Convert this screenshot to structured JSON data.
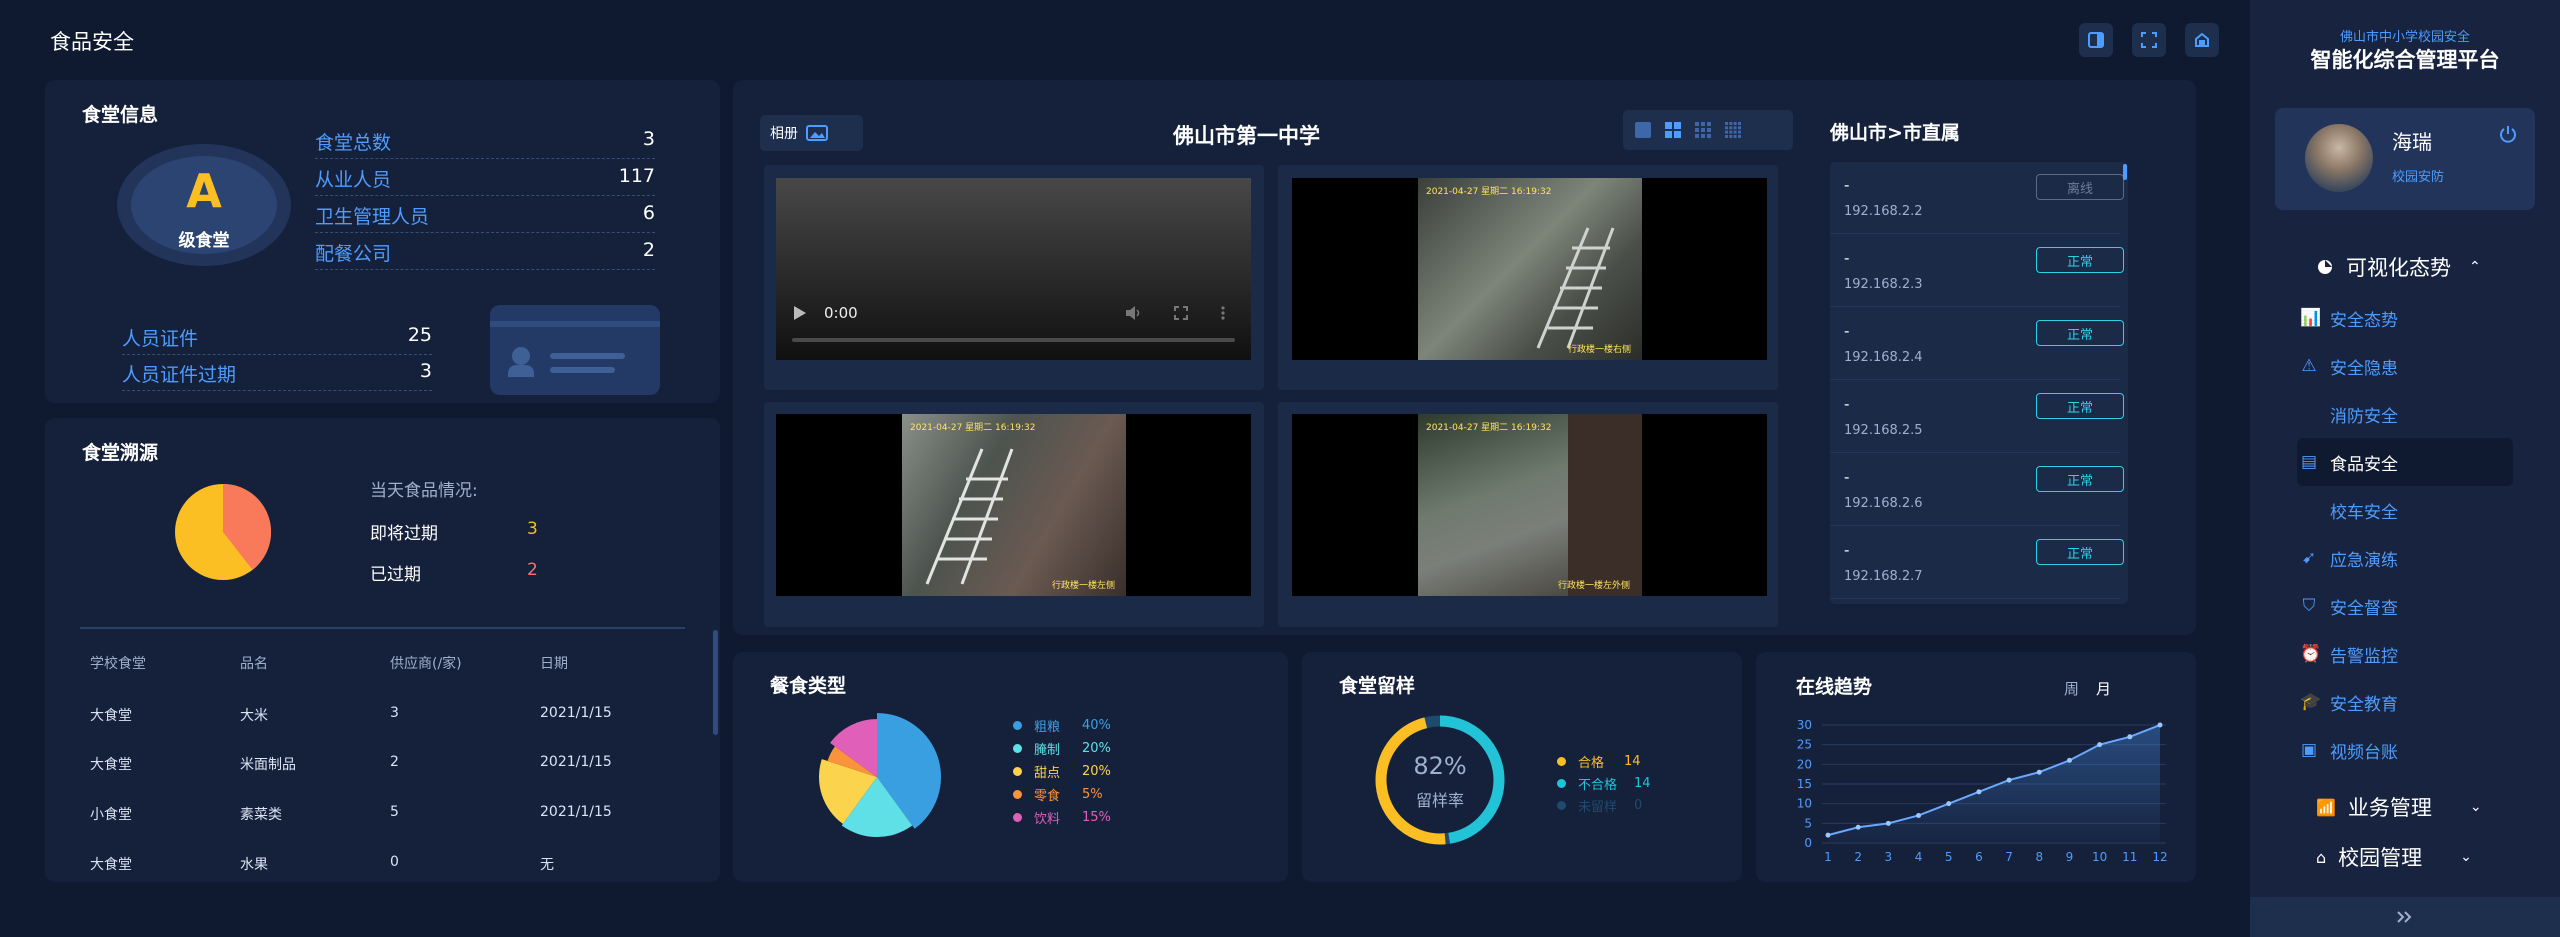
{
  "header": {
    "title": "食品安全"
  },
  "canteen_info": {
    "title": "食堂信息",
    "grade": "A",
    "grade_label": "级食堂",
    "stats": [
      {
        "label": "食堂总数",
        "value": "3"
      },
      {
        "label": "从业人员",
        "value": "117"
      },
      {
        "label": "卫生管理人员",
        "value": "6"
      },
      {
        "label": "配餐公司",
        "value": "2"
      }
    ],
    "certs": [
      {
        "label": "人员证件",
        "value": "25"
      },
      {
        "label": "人员证件过期",
        "value": "3"
      }
    ]
  },
  "traceability": {
    "title": "食堂溯源",
    "today_label": "当天食品情况:",
    "expiring_label": "即将过期",
    "expiring_value": "3",
    "expired_label": "已过期",
    "expired_value": "2",
    "columns": [
      "学校食堂",
      "品名",
      "供应商(/家)",
      "日期"
    ],
    "rows": [
      [
        "大食堂",
        "大米",
        "3",
        "2021/1/15"
      ],
      [
        "大食堂",
        "米面制品",
        "2",
        "2021/1/15"
      ],
      [
        "小食堂",
        "素菜类",
        "5",
        "2021/1/15"
      ],
      [
        "大食堂",
        "水果",
        "0",
        "无"
      ]
    ]
  },
  "video": {
    "album_label": "相册",
    "school_title": "佛山市第一中学",
    "player_time": "0:00",
    "cams": [
      {
        "stamp": "2021-04-27 星期二 16:19:32",
        "caption": "行政楼一楼右侧"
      },
      {
        "stamp": "2021-04-27 星期二 16:19:32",
        "caption": "行政楼一楼左侧"
      },
      {
        "stamp": "2021-04-27 星期二 16:19:32",
        "caption": "行政楼一楼左外侧"
      }
    ]
  },
  "devices": {
    "title": "佛山市>市直属",
    "items": [
      {
        "name": "-",
        "ip": "192.168.2.2",
        "status": "离线"
      },
      {
        "name": "-",
        "ip": "192.168.2.3",
        "status": "正常"
      },
      {
        "name": "-",
        "ip": "192.168.2.4",
        "status": "正常"
      },
      {
        "name": "-",
        "ip": "192.168.2.5",
        "status": "正常"
      },
      {
        "name": "-",
        "ip": "192.168.2.6",
        "status": "正常"
      },
      {
        "name": "-",
        "ip": "192.168.2.7",
        "status": "正常"
      }
    ]
  },
  "meal_types": {
    "title": "餐食类型",
    "items": [
      {
        "name": "粗粮",
        "pct": "40%",
        "value": 40,
        "color": "#3a9fe0"
      },
      {
        "name": "腌制",
        "pct": "20%",
        "value": 20,
        "color": "#5fe0e6"
      },
      {
        "name": "甜点",
        "pct": "20%",
        "value": 20,
        "color": "#fcd34d"
      },
      {
        "name": "零食",
        "pct": "5%",
        "value": 5,
        "color": "#fb923c"
      },
      {
        "name": "饮料",
        "pct": "15%",
        "value": 15,
        "color": "#e05fb8"
      }
    ]
  },
  "sample": {
    "title": "食堂留样",
    "percent": "82%",
    "rate_label": "留样率",
    "items": [
      {
        "name": "合格",
        "value": "14",
        "color": "#fbbf24"
      },
      {
        "name": "不合格",
        "value": "14",
        "color": "#22c3d6"
      },
      {
        "name": "未留样",
        "value": "0",
        "color": "#1f4a6e"
      }
    ]
  },
  "trend": {
    "title": "在线趋势",
    "tab_week": "周",
    "tab_month": "月"
  },
  "chart_data": {
    "type": "area",
    "title": "在线趋势",
    "x": [
      "1",
      "2",
      "3",
      "4",
      "5",
      "6",
      "7",
      "8",
      "9",
      "10",
      "11",
      "12"
    ],
    "series": [
      {
        "values": [
          2,
          4,
          5,
          7,
          10,
          13,
          16,
          18,
          21,
          25,
          27,
          30
        ]
      }
    ],
    "ylim": [
      0,
      30
    ],
    "yticks": [
      "0",
      "5",
      "10",
      "15",
      "20",
      "25",
      "30"
    ],
    "grid": true
  },
  "sidebar": {
    "subtitle": "佛山市中小学校园安全",
    "title": "智能化综合管理平台",
    "user_name": "海瑞",
    "user_role": "校园安防",
    "group1": "可视化态势",
    "items": [
      {
        "label": "安全态势",
        "icon": "bar-chart-icon"
      },
      {
        "label": "安全隐患",
        "icon": "hazard-icon"
      },
      {
        "label": "消防安全",
        "icon": ""
      },
      {
        "label": "食品安全",
        "icon": "food-icon"
      },
      {
        "label": "校车安全",
        "icon": ""
      },
      {
        "label": "应急演练",
        "icon": "drill-icon"
      },
      {
        "label": "安全督查",
        "icon": "shield-icon"
      },
      {
        "label": "告警监控",
        "icon": "alarm-icon"
      },
      {
        "label": "安全教育",
        "icon": "education-icon"
      },
      {
        "label": "视频台账",
        "icon": "video-icon"
      }
    ],
    "group2": "业务管理",
    "group3": "校园管理"
  }
}
